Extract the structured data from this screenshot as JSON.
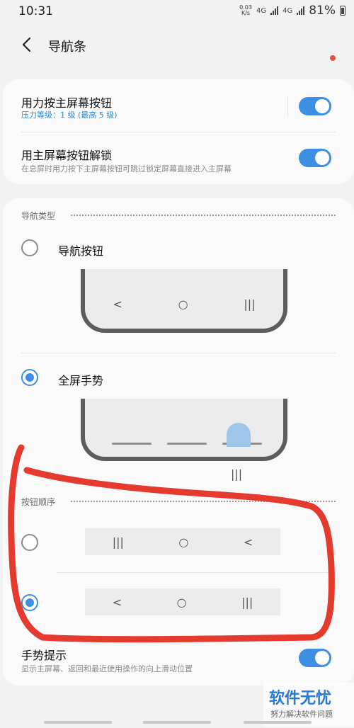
{
  "status": {
    "time": "10:31",
    "net_speed_value": "0.03",
    "net_speed_unit": "K/s",
    "net_type_1": "4G",
    "net_type_2": "4G",
    "battery": "81%"
  },
  "header": {
    "title": "导航条"
  },
  "settings": {
    "pressure": {
      "title": "用力按主屏幕按钮",
      "subtitle": "压力等级：1 级 (最高 5 级)",
      "enabled": true
    },
    "unlock": {
      "title": "用主屏幕按钮解锁",
      "subtitle": "在息屏时用力按下主屏幕按钮可跳过锁定屏幕直接进入主屏幕",
      "enabled": true
    }
  },
  "nav_type": {
    "section_label": "导航类型",
    "options": [
      {
        "label": "导航按钮",
        "selected": false
      },
      {
        "label": "全屏手势",
        "selected": true
      }
    ],
    "gesture_hint_icon": "|||"
  },
  "button_order": {
    "section_label": "按钮顺序",
    "options": [
      {
        "icons": [
          "|||",
          "○",
          "<"
        ],
        "selected": false
      },
      {
        "icons": [
          "<",
          "○",
          "|||"
        ],
        "selected": true
      }
    ]
  },
  "gesture_hint": {
    "title": "手势提示",
    "subtitle": "显示主屏幕、返回和最近使用操作的向上滑动位置",
    "enabled": true
  },
  "nav_preview_icons": [
    "<",
    "○",
    "|||"
  ],
  "watermark": {
    "main": "软件无忧",
    "sub": "努力解决软件问题"
  },
  "colors": {
    "accent": "#3c8fe3",
    "annotation": "#e53a2e",
    "subtitle_blue": "#2a8ad8"
  }
}
